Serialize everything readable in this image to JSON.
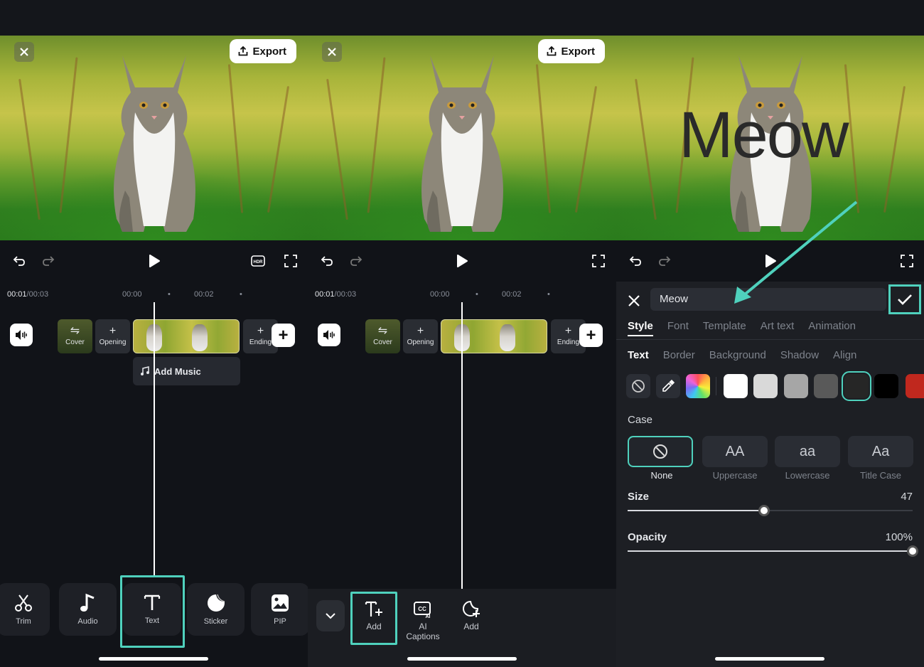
{
  "common": {
    "export_label": "Export",
    "current_time": "00:01",
    "total_time": "/00:03",
    "tick_0": "00:00",
    "tick_2": "00:02",
    "cover_label": "Cover",
    "opening_label": "Opening",
    "ending_label": "Ending"
  },
  "panel1": {
    "add_music_label": "Add Music",
    "toolbar": [
      {
        "label": "Trim",
        "icon": "scissors-icon"
      },
      {
        "label": "Audio",
        "icon": "music-note-icon"
      },
      {
        "label": "Text",
        "icon": "text-icon"
      },
      {
        "label": "Sticker",
        "icon": "sticker-icon"
      },
      {
        "label": "PIP",
        "icon": "pip-icon"
      }
    ]
  },
  "panel2": {
    "toolbar": [
      {
        "label": "Add",
        "icon": "add-text-icon"
      },
      {
        "label": "AI Captions",
        "icon": "ai-captions-icon"
      },
      {
        "label": "Add",
        "icon": "add-sticker-icon"
      }
    ]
  },
  "panel3": {
    "overlay_text": "Meow",
    "input_value": "Meow",
    "tabs": [
      "Style",
      "Font",
      "Template",
      "Art text",
      "Animation"
    ],
    "subtabs": [
      "Text",
      "Border",
      "Background",
      "Shadow",
      "Align"
    ],
    "swatch_colors": [
      "#ffffff",
      "#d9d9d9",
      "#a6a6a6",
      "#595959",
      "#262626",
      "#000000",
      "#c0281e"
    ],
    "case_label": "Case",
    "case_options": [
      {
        "display": "",
        "label": "None"
      },
      {
        "display": "AA",
        "label": "Uppercase"
      },
      {
        "display": "aa",
        "label": "Lowercase"
      },
      {
        "display": "Aa",
        "label": "Title Case"
      }
    ],
    "size_label": "Size",
    "size_value": "47",
    "opacity_label": "Opacity",
    "opacity_value": "100%"
  },
  "colors": {
    "accent": "#4fd1bd",
    "background": "#111318"
  }
}
